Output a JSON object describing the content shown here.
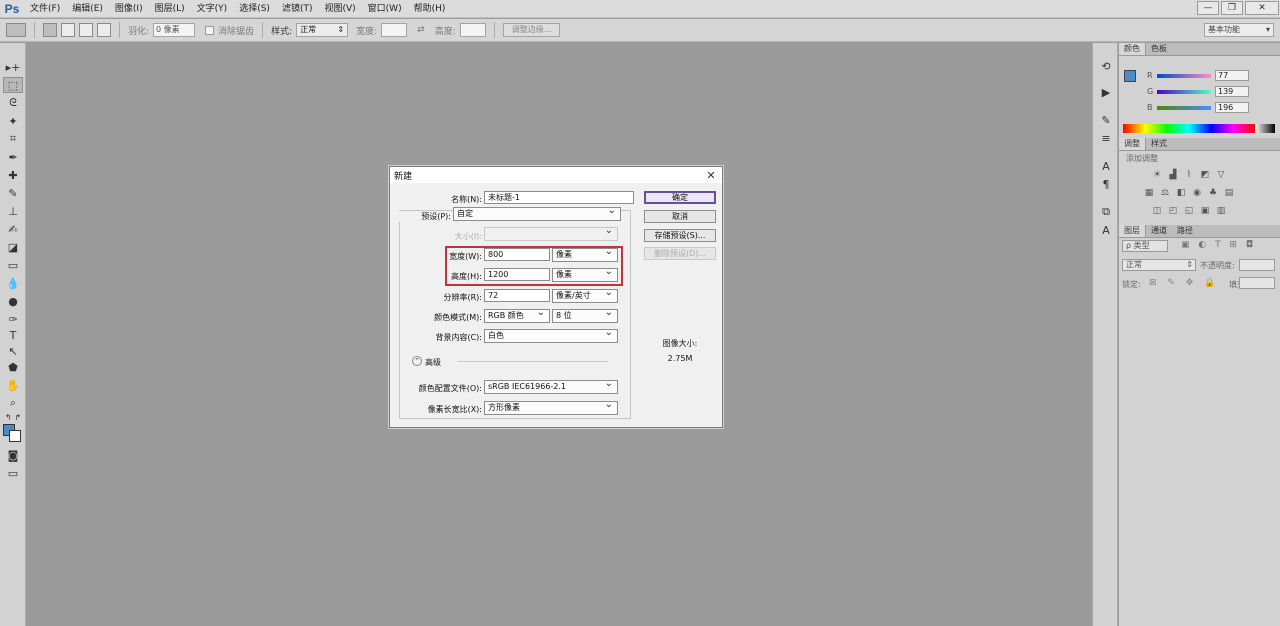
{
  "app": {
    "logo": "Ps",
    "menus": [
      "文件(F)",
      "编辑(E)",
      "图像(I)",
      "图层(L)",
      "文字(Y)",
      "选择(S)",
      "滤镜(T)",
      "视图(V)",
      "窗口(W)",
      "帮助(H)"
    ],
    "window_controls": {
      "minimize": "—",
      "restore": "❐",
      "close": "✕"
    }
  },
  "options_bar": {
    "feather_label": "羽化:",
    "feather_value": "0 像素",
    "antialias_label": "消除锯齿",
    "style_label": "样式:",
    "style_value": "正常",
    "width_label": "宽度:",
    "height_label": "高度:",
    "refine_edge_button": "调整边缘...",
    "workspace": "基本功能"
  },
  "color_panel": {
    "tabs": [
      "颜色",
      "色板"
    ],
    "channels": [
      {
        "label": "R",
        "value": "77",
        "gradient": [
          "#004dc4",
          "#ff8bc4"
        ]
      },
      {
        "label": "G",
        "value": "139",
        "gradient": [
          "#4d00c4",
          "#4dffc4"
        ]
      },
      {
        "label": "B",
        "value": "196",
        "gradient": [
          "#4d8b00",
          "#4d8bff"
        ]
      }
    ],
    "foreground": "#4d8bc4"
  },
  "adjustments_panel": {
    "tabs": [
      "调整",
      "样式"
    ],
    "heading": "添加调整"
  },
  "layers_panel": {
    "tabs": [
      "图层",
      "通道",
      "路径"
    ],
    "filter_label": "ρ 类型",
    "blend_mode": "正常",
    "opacity_label": "不透明度:",
    "lock_label": "锁定:",
    "fill_label": "填充:"
  },
  "dialog": {
    "title": "新建",
    "name_label": "名称(N):",
    "name_value": "未标题-1",
    "preset_label": "预设(P):",
    "preset_value": "自定",
    "size_label": "大小(I):",
    "width_label": "宽度(W):",
    "width_value": "800",
    "width_unit": "像素",
    "height_label": "高度(H):",
    "height_value": "1200",
    "height_unit": "像素",
    "resolution_label": "分辨率(R):",
    "resolution_value": "72",
    "resolution_unit": "像素/英寸",
    "color_mode_label": "颜色模式(M):",
    "color_mode_value": "RGB 颜色",
    "bit_depth": "8 位",
    "background_label": "背景内容(C):",
    "background_value": "白色",
    "advanced_label": "高级",
    "profile_label": "颜色配置文件(O):",
    "profile_value": "sRGB IEC61966-2.1",
    "aspect_label": "像素长宽比(X):",
    "aspect_value": "方形像素",
    "ok_button": "确定",
    "cancel_button": "取消",
    "save_preset_button": "存储预设(S)...",
    "delete_preset_button": "删除预设(D)...",
    "image_size_label": "图像大小:",
    "image_size_value": "2.75M",
    "highlight_color": "#c3333d"
  }
}
